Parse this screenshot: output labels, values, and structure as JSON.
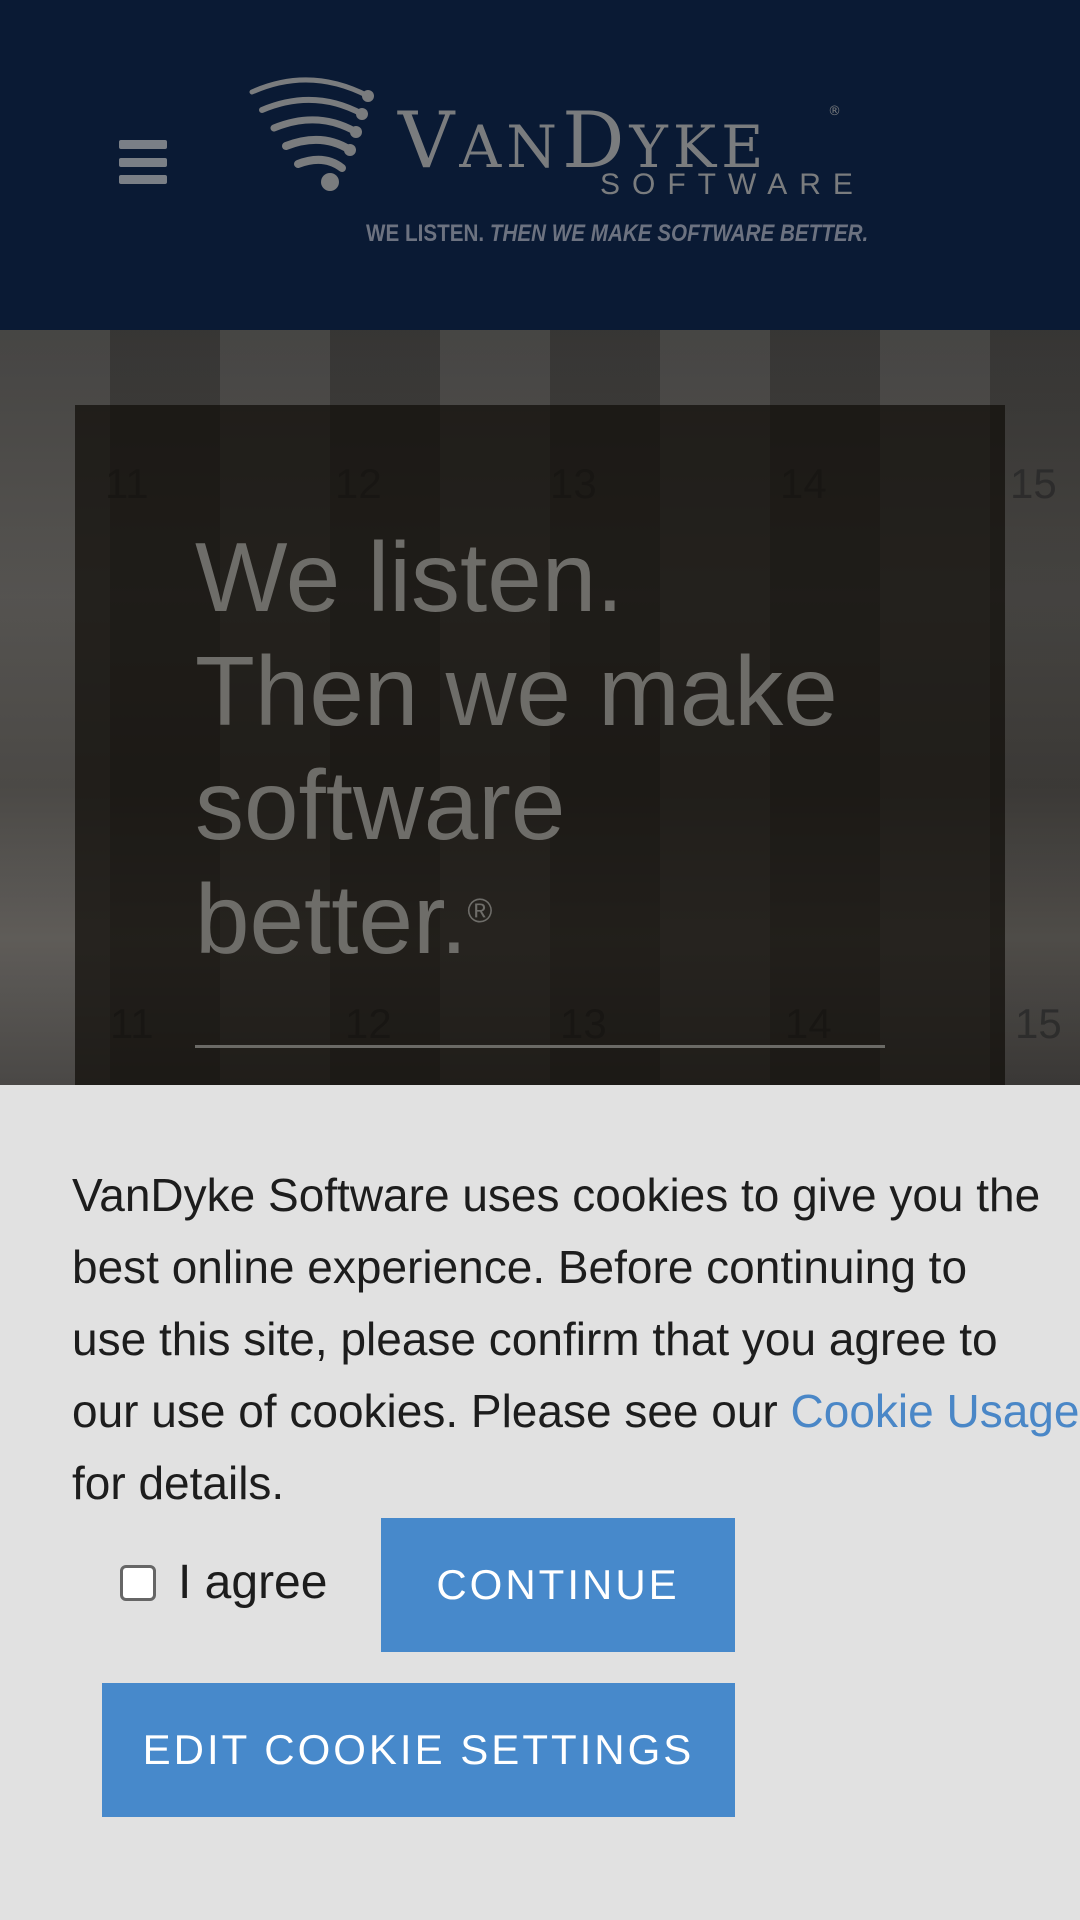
{
  "header": {
    "menu_icon": "hamburger-menu-icon",
    "logo": {
      "word_v": "V",
      "word_an": "AN",
      "word_d": "D",
      "word_yke": "YKE",
      "registered": "®",
      "subword": "SOFTWARE",
      "tagline_plain": "WE LISTEN.",
      "tagline_italic": "THEN WE MAKE SOFTWARE BETTER."
    },
    "colors": {
      "background": "#0a1a34",
      "logo": "#7a7c7e"
    }
  },
  "hero": {
    "heading_lines": [
      "We listen.",
      "Then we make",
      "software",
      "better."
    ],
    "registered": "®",
    "photo_numbers": [
      "11",
      "12",
      "13",
      "14",
      "15",
      "11",
      "12",
      "13",
      "14",
      "15"
    ]
  },
  "cookie_banner": {
    "text_lines": [
      "VanDyke Software uses cookies to give you the",
      "best online experience. Before continuing to",
      "use this site, please confirm that you agree to",
      "our use of cookies. Please see our "
    ],
    "link_text": "Cookie Usage",
    "text_end": "for details.",
    "agree_label": "I agree",
    "agree_checked": false,
    "continue_label": "CONTINUE",
    "edit_settings_label": "EDIT COOKIE SETTINGS",
    "colors": {
      "background": "#e1e1e1",
      "button": "#4789cb",
      "link": "#4a87c7"
    }
  }
}
